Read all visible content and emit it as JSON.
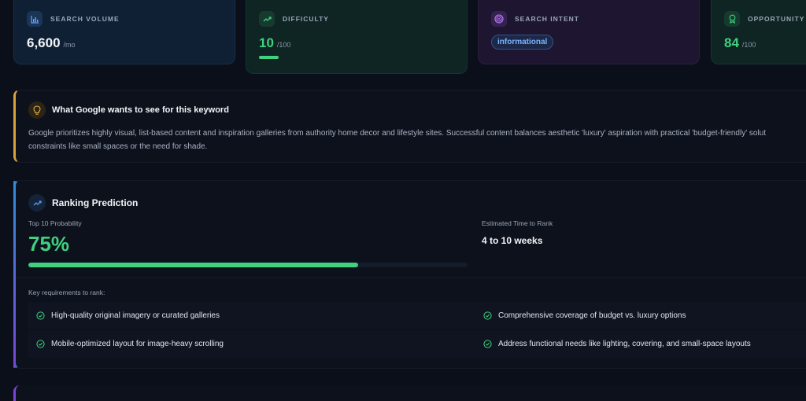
{
  "metrics": {
    "volume": {
      "label": "SEARCH VOLUME",
      "value": "6,600",
      "unit": "/mo",
      "icon": "bar-chart-icon"
    },
    "difficulty": {
      "label": "DIFFICULTY",
      "value": "10",
      "unit": "/100",
      "icon": "trend-up-icon",
      "level": 0.1
    },
    "intent": {
      "label": "SEARCH INTENT",
      "value": "informational",
      "icon": "target-icon"
    },
    "opportunity": {
      "label": "OPPORTUNITY",
      "value": "84",
      "unit": "/100",
      "icon": "award-icon"
    }
  },
  "insight": {
    "title": "What Google wants to see for this keyword",
    "line1": "Google prioritizes highly visual, list-based content and inspiration galleries from authority home decor and lifestyle sites. Successful content balances aesthetic 'luxury' aspiration with practical 'budget-friendly' solut",
    "line2": "constraints like small spaces or the need for shade.",
    "icon": "lightbulb-icon",
    "accent": "#d9a23a"
  },
  "ranking": {
    "title": "Ranking Prediction",
    "icon": "trend-up-icon",
    "probability_label": "Top 10 Probability",
    "probability_value": "75%",
    "probability": 0.75,
    "time_label": "Estimated Time to Rank",
    "time_value": "4 to 10 weeks",
    "requirements_label": "Key requirements to rank:",
    "requirements": [
      "High-quality original imagery or curated galleries",
      "Comprehensive coverage of budget vs. luxury options",
      "Mobile-optimized layout for image-heavy scrolling",
      "Address functional needs like lighting, covering, and small-space layouts"
    ]
  },
  "colors": {
    "background": "#0b0f1a",
    "green": "#3fd17f",
    "blue": "#7fb2ff",
    "amber": "#d9a23a",
    "purple": "#7a45d6"
  }
}
